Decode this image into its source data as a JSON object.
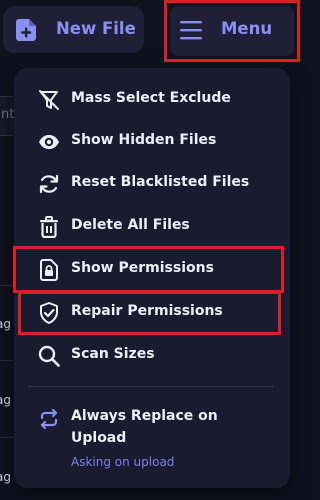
{
  "toolbar": {
    "new_file_label": "New File",
    "menu_label": "Menu"
  },
  "background": {
    "search_fragment": "nt",
    "row_fragments": [
      "ag",
      "ag",
      "ag"
    ]
  },
  "menu": {
    "items": [
      {
        "label": "Mass Select Exclude",
        "icon": "filter-off-icon"
      },
      {
        "label": "Show Hidden Files",
        "icon": "eye-icon"
      },
      {
        "label": "Reset Blacklisted Files",
        "icon": "refresh-icon"
      },
      {
        "label": "Delete All Files",
        "icon": "trash-icon"
      },
      {
        "label": "Show Permissions",
        "icon": "lock-file-icon"
      },
      {
        "label": "Repair Permissions",
        "icon": "shield-check-icon"
      },
      {
        "label": "Scan Sizes",
        "icon": "search-icon"
      }
    ],
    "toggle": {
      "label": "Always Replace on Upload",
      "status": "Asking on upload",
      "icon": "repeat-icon"
    }
  },
  "colors": {
    "accent": "#8a8ff2",
    "highlight": "#d8202a",
    "panel": "#1a1b2e",
    "background": "#11111e"
  }
}
